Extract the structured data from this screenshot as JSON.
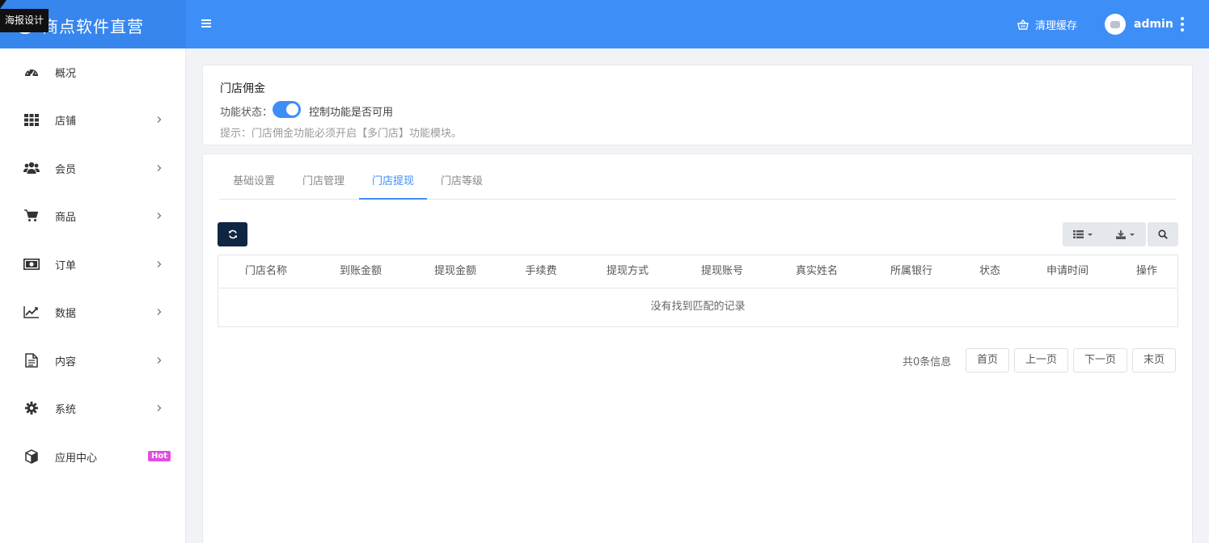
{
  "header": {
    "brand_name": "商点软件直营",
    "tooltip": "海报设计",
    "clear_cache": "清理缓存",
    "username": "admin"
  },
  "sidebar": {
    "items": [
      {
        "label": "概况",
        "icon": "dashboard-icon",
        "has_children": false
      },
      {
        "label": "店铺",
        "icon": "grid-icon",
        "has_children": true
      },
      {
        "label": "会员",
        "icon": "users-icon",
        "has_children": true
      },
      {
        "label": "商品",
        "icon": "cart-icon",
        "has_children": true
      },
      {
        "label": "订单",
        "icon": "money-icon",
        "has_children": true
      },
      {
        "label": "数据",
        "icon": "line-chart-icon",
        "has_children": true
      },
      {
        "label": "内容",
        "icon": "document-icon",
        "has_children": true
      },
      {
        "label": "系统",
        "icon": "gear-icon",
        "has_children": true
      },
      {
        "label": "应用中心",
        "icon": "cube-icon",
        "has_children": false,
        "badge": "Hot"
      }
    ]
  },
  "config_panel": {
    "title": "门店佣金",
    "status_label": "功能状态：",
    "switch_on": true,
    "switch_desc": "控制功能是否可用",
    "tip": "提示：门店佣金功能必须开启【多门店】功能模块。"
  },
  "tabs": [
    {
      "label": "基础设置",
      "active": false
    },
    {
      "label": "门店管理",
      "active": false
    },
    {
      "label": "门店提现",
      "active": true
    },
    {
      "label": "门店等级",
      "active": false
    }
  ],
  "table": {
    "columns": [
      "门店名称",
      "到账金额",
      "提现金额",
      "手续费",
      "提现方式",
      "提现账号",
      "真实姓名",
      "所属银行",
      "状态",
      "申请时间",
      "操作"
    ],
    "empty_text": "没有找到匹配的记录"
  },
  "pagination": {
    "info": "共0条信息",
    "first": "首页",
    "prev": "上一页",
    "next": "下一页",
    "last": "末页"
  },
  "colors": {
    "primary": "#3e8ef7",
    "dark_button": "#0f2642",
    "hot_badge": "#e24ee0"
  }
}
